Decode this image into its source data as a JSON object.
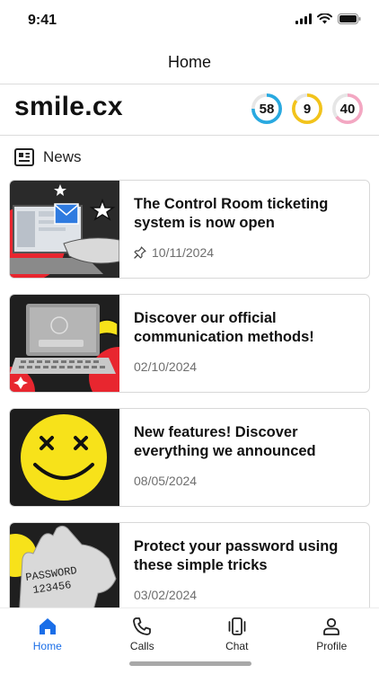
{
  "status_bar": {
    "time": "9:41",
    "icons": [
      "signal-icon",
      "wifi-icon",
      "battery-icon"
    ]
  },
  "nav": {
    "title": "Home"
  },
  "brand": {
    "logo_text": "smile.cx",
    "rings": [
      {
        "value": "58",
        "color": "#29a9e0",
        "fill": 0.75
      },
      {
        "value": "9",
        "color": "#f2c31b",
        "fill": 0.85
      },
      {
        "value": "40",
        "color": "#f3a7c2",
        "fill": 0.65
      }
    ]
  },
  "section": {
    "icon": "newspaper-icon",
    "title": "News"
  },
  "news": [
    {
      "title": "The Control Room ticketing system is now open",
      "date": "10/11/2024",
      "pinned": true,
      "thumb": "laptop-tickets"
    },
    {
      "title": "Discover our official communication methods!",
      "date": "02/10/2024",
      "pinned": false,
      "thumb": "password-laptop"
    },
    {
      "title": "New features! Discover everything we announced",
      "date": "08/05/2024",
      "pinned": false,
      "thumb": "smiley"
    },
    {
      "title": "Protect your password using these simple tricks",
      "date": "03/02/2024",
      "pinned": false,
      "thumb": "hand-password",
      "hand_text_1": "PASSWORD",
      "hand_text_2": "123456"
    }
  ],
  "tabs": [
    {
      "label": "Home",
      "icon": "home-icon",
      "active": true
    },
    {
      "label": "Calls",
      "icon": "phone-icon",
      "active": false
    },
    {
      "label": "Chat",
      "icon": "chat-device-icon",
      "active": false
    },
    {
      "label": "Profile",
      "icon": "profile-icon",
      "active": false
    }
  ],
  "colors": {
    "accent": "#1a6ee8",
    "thumb_red": "#e8262f",
    "thumb_yellow": "#f7e21a"
  }
}
